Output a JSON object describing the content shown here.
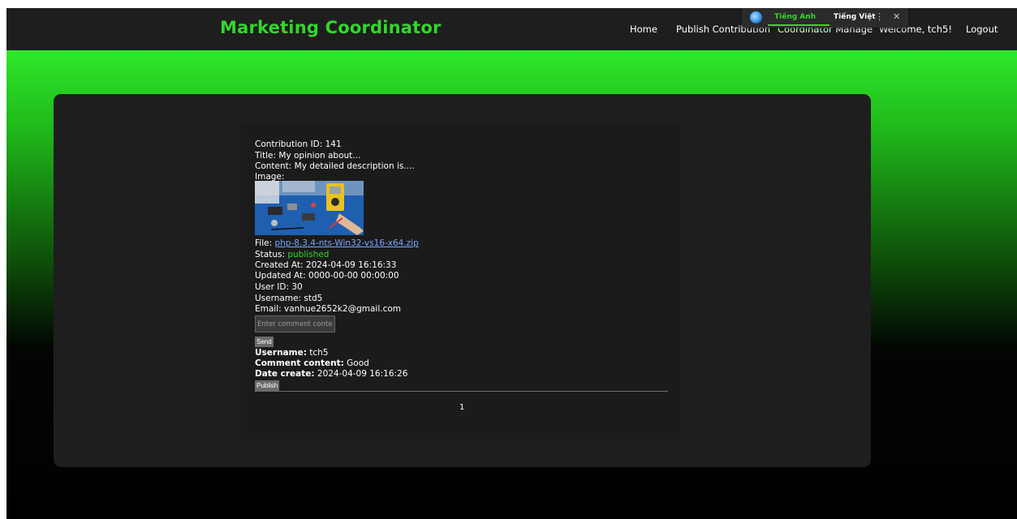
{
  "navbar": {
    "brand": "Marketing Coordinator",
    "items": {
      "home": "Home",
      "publish": "Publish Contribution",
      "manage": "Coordinator Manage",
      "welcome": "Welcome, tch5!",
      "logout": "Logout"
    }
  },
  "translate_bar": {
    "lang_english": "Tiếng Anh",
    "lang_vietnamese": "Tiếng Việt",
    "more": "⋮",
    "close": "✕",
    "icon": "globe-icon"
  },
  "contribution": {
    "id_label": "Contribution ID:",
    "id": "141",
    "title_label": "Title:",
    "title": "My opinion about...",
    "content_label": "Content:",
    "content": "My detailed description is....",
    "image_label": "Image:",
    "file_label": "File:",
    "file": "php-8.3.4-nts-Win32-vs16-x64.zip",
    "status_label": "Status:",
    "status": "published",
    "status_color": "#32d72c",
    "created_label": "Created At:",
    "created": "2024-04-09 16:16:33",
    "updated_label": "Updated At:",
    "updated": "0000-00-00 00:00:00",
    "user_id_label": "User ID:",
    "user_id": "30",
    "username_label": "Username:",
    "username": "std5",
    "email_label": "Email:",
    "email": "vanhue2652k2@gmail.com"
  },
  "comment_form": {
    "placeholder": "Enter comment content",
    "send_label": "Send"
  },
  "comment": {
    "username_label": "Username:",
    "username": "tch5",
    "content_label": "Comment content:",
    "content": "Good",
    "date_label": "Date create:",
    "date": "2024-04-09 16:16:26"
  },
  "publish_label": "Publish",
  "pagination": {
    "current": "1"
  },
  "colors": {
    "accent": "#32d72c",
    "navbar": "#1e1e1e",
    "card": "#1e1e1e",
    "link": "#7ba7ff"
  }
}
